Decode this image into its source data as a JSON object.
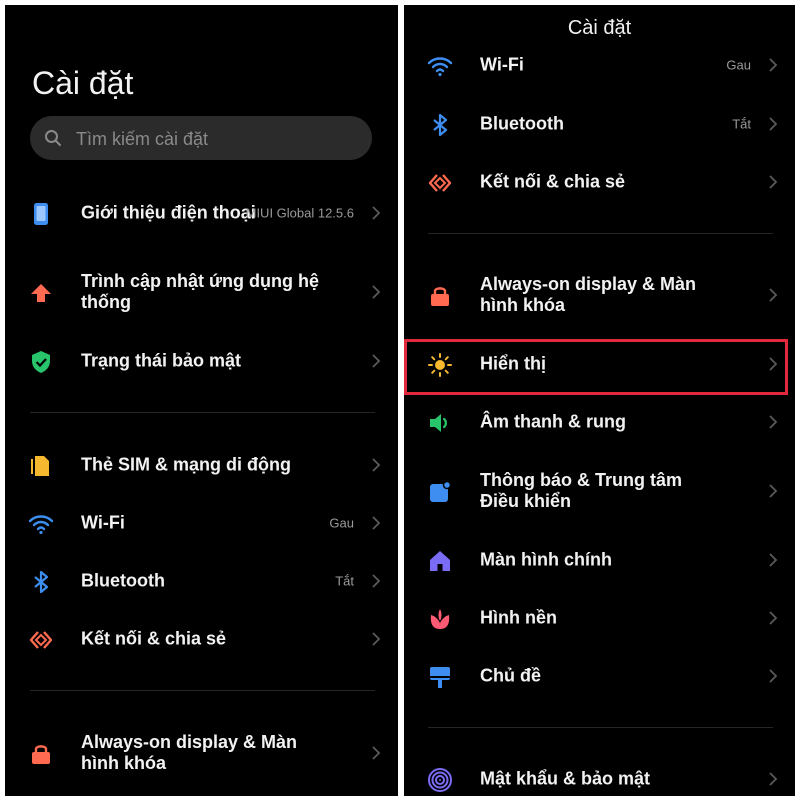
{
  "left": {
    "title": "Cài đặt",
    "search_placeholder": "Tìm kiếm cài đặt",
    "items": [
      {
        "label": "Giới thiệu điện thoại",
        "value": "MIUI Global 12.5.6",
        "icon": "phone-icon",
        "color": "#3d8ef0"
      },
      {
        "label": "Trình cập nhật ứng dụng hệ thống",
        "value": "",
        "icon": "arrow-up-icon",
        "color": "#ff6a50"
      },
      {
        "label": "Trạng thái bảo mật",
        "value": "",
        "icon": "shield-check-icon",
        "color": "#27c46b"
      },
      {
        "label": "Thẻ SIM & mạng di động",
        "value": "",
        "icon": "sim-card-icon",
        "color": "#f5b82e"
      },
      {
        "label": "Wi-Fi",
        "value": "Gau",
        "icon": "wifi-icon",
        "color": "#3d8ef0"
      },
      {
        "label": "Bluetooth",
        "value": "Tắt",
        "icon": "bluetooth-icon",
        "color": "#3d8ef0"
      },
      {
        "label": "Kết nối & chia sẻ",
        "value": "",
        "icon": "connection-share-icon",
        "color": "#ff6a50"
      },
      {
        "label": "Always-on display & Màn hình khóa",
        "value": "",
        "icon": "lock-icon",
        "color": "#ff6a50"
      }
    ]
  },
  "right": {
    "title": "Cài đặt",
    "items": [
      {
        "label": "Wi-Fi",
        "value": "Gau",
        "icon": "wifi-icon",
        "color": "#3d8ef0"
      },
      {
        "label": "Bluetooth",
        "value": "Tắt",
        "icon": "bluetooth-icon",
        "color": "#3d8ef0"
      },
      {
        "label": "Kết nối & chia sẻ",
        "value": "",
        "icon": "connection-share-icon",
        "color": "#ff6a50"
      },
      {
        "label": "Always-on display & Màn hình khóa",
        "value": "",
        "icon": "lock-icon",
        "color": "#ff6a50"
      },
      {
        "label": "Hiển thị",
        "value": "",
        "icon": "sun-icon",
        "color": "#f5b82e"
      },
      {
        "label": "Âm thanh & rung",
        "value": "",
        "icon": "speaker-icon",
        "color": "#27c46b"
      },
      {
        "label": "Thông báo & Trung tâm Điều khiển",
        "value": "",
        "icon": "notification-icon",
        "color": "#3d8ef0"
      },
      {
        "label": "Màn hình chính",
        "value": "",
        "icon": "home-icon",
        "color": "#7b6cf6"
      },
      {
        "label": "Hình nền",
        "value": "",
        "icon": "wallpaper-icon",
        "color": "#ff5a73"
      },
      {
        "label": "Chủ đề",
        "value": "",
        "icon": "theme-icon",
        "color": "#3d8ef0"
      },
      {
        "label": "Mật khẩu & bảo mật",
        "value": "",
        "icon": "fingerprint-icon",
        "color": "#7b6cf6"
      }
    ],
    "highlight_color": "#e0293b"
  }
}
